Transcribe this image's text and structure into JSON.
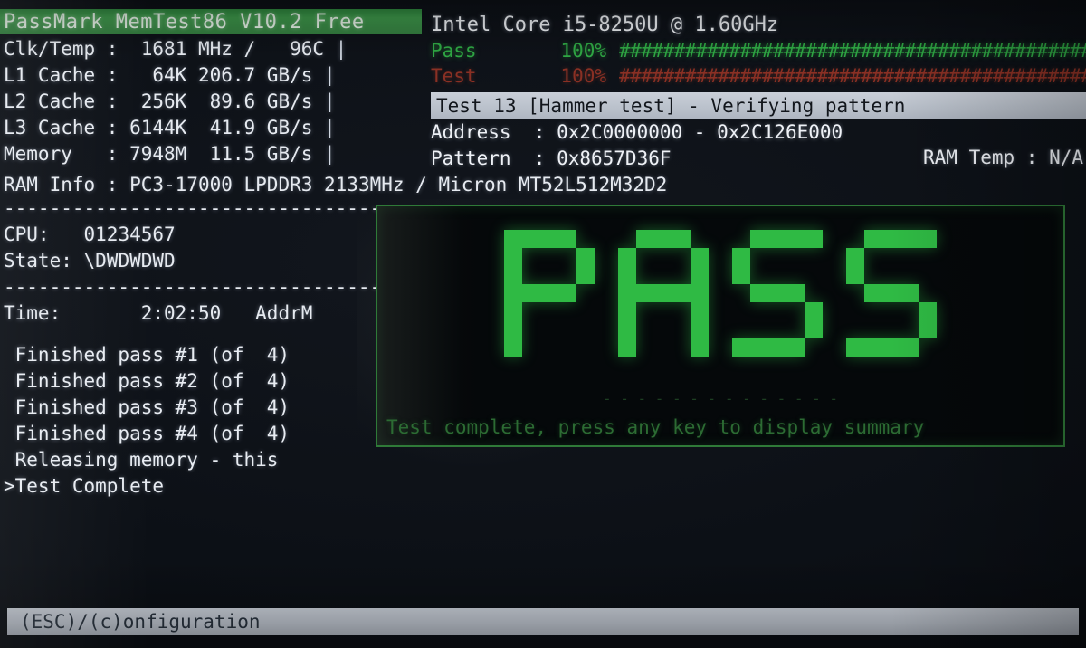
{
  "app": {
    "title": "PassMark MemTest86 V10.2 Free",
    "cpu_name": "Intel Core i5-8250U @ 1.60GHz"
  },
  "sysinfo": {
    "rows": [
      {
        "label": "Clk/Temp :",
        "value": "  1681 MHz /   96C",
        "pipe": "|"
      },
      {
        "label": "L1 Cache :",
        "value": "   64K 206.7 GB/s",
        "pipe": "|"
      },
      {
        "label": "L2 Cache :",
        "value": "  256K  89.6 GB/s",
        "pipe": "|"
      },
      {
        "label": "L3 Cache :",
        "value": " 6144K  41.9 GB/s",
        "pipe": "|"
      },
      {
        "label": "Memory   :",
        "value": " 7948M  11.5 GB/s",
        "pipe": "|"
      }
    ],
    "ram_info_label": "RAM Info :",
    "ram_info_value": " PC3-17000 LPDDR3 2133MHz / Micron MT52L512M32D2"
  },
  "progress": {
    "pass": {
      "label": "Pass",
      "percent": "100%",
      "hashes": "################################################",
      "color": "#2fa844"
    },
    "test": {
      "label": "Test",
      "percent": "100%",
      "hashes": "################################################",
      "color": "#8a3024"
    }
  },
  "current_test": {
    "line": "Test 13 [Hammer test] - Verifying pattern",
    "address_label": "Address  : ",
    "address_value": "0x2C0000000 - 0x2C126E000",
    "pattern_label": "Pattern  : ",
    "pattern_value": "0x8657D36F",
    "ram_temp_label": "RAM Temp : ",
    "ram_temp_value": "N/A"
  },
  "cpu_block": {
    "separator_top": "-----------------------------------",
    "cpu_label": "CPU:   ",
    "cpu_value": "01234567",
    "state_label": "State: ",
    "state_value": "\\DWDWDWD",
    "separator_mid": "-----------------------------------",
    "time_label": "Time:     ",
    "time_value": "  2:02:50",
    "addr_mode": "   AddrM"
  },
  "pass_log": {
    "lines": [
      " Finished pass #1 (of  4)",
      " Finished pass #2 (of  4)",
      " Finished pass #3 (of  4)",
      " Finished pass #4 (of  4)",
      " Releasing memory - this",
      ">Test Complete"
    ]
  },
  "result_box": {
    "verdict": "PASS",
    "message": "Test complete, press any key to display summary",
    "dashes": "- - - - - - - - - - - - - -",
    "border_color": "#2f7a38",
    "text_color": "#2fba44"
  },
  "bottom_bar": {
    "text": "(ESC)/(c)onfiguration"
  }
}
